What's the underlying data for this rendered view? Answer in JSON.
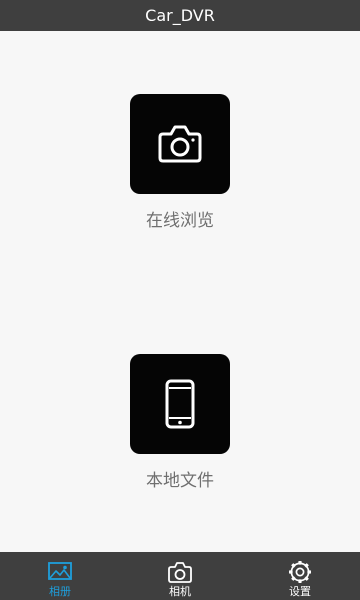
{
  "app": {
    "title": "Car_DVR"
  },
  "main": {
    "tiles": [
      {
        "label": "在线浏览",
        "icon": "camera-icon"
      },
      {
        "label": "本地文件",
        "icon": "smartphone-icon"
      }
    ]
  },
  "tabs": [
    {
      "label": "相册",
      "icon": "gallery-icon",
      "active": true
    },
    {
      "label": "相机",
      "icon": "camera-icon",
      "active": false
    },
    {
      "label": "设置",
      "icon": "gear-icon",
      "active": false
    }
  ],
  "colors": {
    "bar": "#3f3f3f",
    "background": "#f7f7f7",
    "tile": "#050505",
    "accent": "#1e9fdc",
    "label": "#6f6f6f"
  }
}
